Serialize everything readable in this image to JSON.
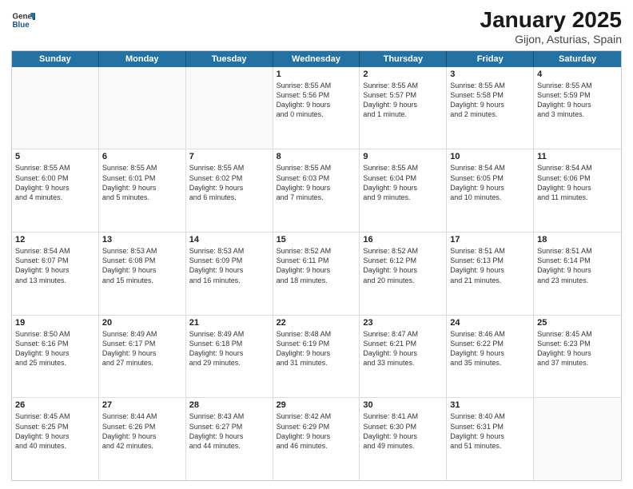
{
  "header": {
    "logo_general": "General",
    "logo_blue": "Blue",
    "title": "January 2025",
    "subtitle": "Gijon, Asturias, Spain"
  },
  "weekdays": [
    "Sunday",
    "Monday",
    "Tuesday",
    "Wednesday",
    "Thursday",
    "Friday",
    "Saturday"
  ],
  "rows": [
    [
      {
        "day": "",
        "info": ""
      },
      {
        "day": "",
        "info": ""
      },
      {
        "day": "",
        "info": ""
      },
      {
        "day": "1",
        "info": "Sunrise: 8:55 AM\nSunset: 5:56 PM\nDaylight: 9 hours\nand 0 minutes."
      },
      {
        "day": "2",
        "info": "Sunrise: 8:55 AM\nSunset: 5:57 PM\nDaylight: 9 hours\nand 1 minute."
      },
      {
        "day": "3",
        "info": "Sunrise: 8:55 AM\nSunset: 5:58 PM\nDaylight: 9 hours\nand 2 minutes."
      },
      {
        "day": "4",
        "info": "Sunrise: 8:55 AM\nSunset: 5:59 PM\nDaylight: 9 hours\nand 3 minutes."
      }
    ],
    [
      {
        "day": "5",
        "info": "Sunrise: 8:55 AM\nSunset: 6:00 PM\nDaylight: 9 hours\nand 4 minutes."
      },
      {
        "day": "6",
        "info": "Sunrise: 8:55 AM\nSunset: 6:01 PM\nDaylight: 9 hours\nand 5 minutes."
      },
      {
        "day": "7",
        "info": "Sunrise: 8:55 AM\nSunset: 6:02 PM\nDaylight: 9 hours\nand 6 minutes."
      },
      {
        "day": "8",
        "info": "Sunrise: 8:55 AM\nSunset: 6:03 PM\nDaylight: 9 hours\nand 7 minutes."
      },
      {
        "day": "9",
        "info": "Sunrise: 8:55 AM\nSunset: 6:04 PM\nDaylight: 9 hours\nand 9 minutes."
      },
      {
        "day": "10",
        "info": "Sunrise: 8:54 AM\nSunset: 6:05 PM\nDaylight: 9 hours\nand 10 minutes."
      },
      {
        "day": "11",
        "info": "Sunrise: 8:54 AM\nSunset: 6:06 PM\nDaylight: 9 hours\nand 11 minutes."
      }
    ],
    [
      {
        "day": "12",
        "info": "Sunrise: 8:54 AM\nSunset: 6:07 PM\nDaylight: 9 hours\nand 13 minutes."
      },
      {
        "day": "13",
        "info": "Sunrise: 8:53 AM\nSunset: 6:08 PM\nDaylight: 9 hours\nand 15 minutes."
      },
      {
        "day": "14",
        "info": "Sunrise: 8:53 AM\nSunset: 6:09 PM\nDaylight: 9 hours\nand 16 minutes."
      },
      {
        "day": "15",
        "info": "Sunrise: 8:52 AM\nSunset: 6:11 PM\nDaylight: 9 hours\nand 18 minutes."
      },
      {
        "day": "16",
        "info": "Sunrise: 8:52 AM\nSunset: 6:12 PM\nDaylight: 9 hours\nand 20 minutes."
      },
      {
        "day": "17",
        "info": "Sunrise: 8:51 AM\nSunset: 6:13 PM\nDaylight: 9 hours\nand 21 minutes."
      },
      {
        "day": "18",
        "info": "Sunrise: 8:51 AM\nSunset: 6:14 PM\nDaylight: 9 hours\nand 23 minutes."
      }
    ],
    [
      {
        "day": "19",
        "info": "Sunrise: 8:50 AM\nSunset: 6:16 PM\nDaylight: 9 hours\nand 25 minutes."
      },
      {
        "day": "20",
        "info": "Sunrise: 8:49 AM\nSunset: 6:17 PM\nDaylight: 9 hours\nand 27 minutes."
      },
      {
        "day": "21",
        "info": "Sunrise: 8:49 AM\nSunset: 6:18 PM\nDaylight: 9 hours\nand 29 minutes."
      },
      {
        "day": "22",
        "info": "Sunrise: 8:48 AM\nSunset: 6:19 PM\nDaylight: 9 hours\nand 31 minutes."
      },
      {
        "day": "23",
        "info": "Sunrise: 8:47 AM\nSunset: 6:21 PM\nDaylight: 9 hours\nand 33 minutes."
      },
      {
        "day": "24",
        "info": "Sunrise: 8:46 AM\nSunset: 6:22 PM\nDaylight: 9 hours\nand 35 minutes."
      },
      {
        "day": "25",
        "info": "Sunrise: 8:45 AM\nSunset: 6:23 PM\nDaylight: 9 hours\nand 37 minutes."
      }
    ],
    [
      {
        "day": "26",
        "info": "Sunrise: 8:45 AM\nSunset: 6:25 PM\nDaylight: 9 hours\nand 40 minutes."
      },
      {
        "day": "27",
        "info": "Sunrise: 8:44 AM\nSunset: 6:26 PM\nDaylight: 9 hours\nand 42 minutes."
      },
      {
        "day": "28",
        "info": "Sunrise: 8:43 AM\nSunset: 6:27 PM\nDaylight: 9 hours\nand 44 minutes."
      },
      {
        "day": "29",
        "info": "Sunrise: 8:42 AM\nSunset: 6:29 PM\nDaylight: 9 hours\nand 46 minutes."
      },
      {
        "day": "30",
        "info": "Sunrise: 8:41 AM\nSunset: 6:30 PM\nDaylight: 9 hours\nand 49 minutes."
      },
      {
        "day": "31",
        "info": "Sunrise: 8:40 AM\nSunset: 6:31 PM\nDaylight: 9 hours\nand 51 minutes."
      },
      {
        "day": "",
        "info": ""
      }
    ]
  ]
}
